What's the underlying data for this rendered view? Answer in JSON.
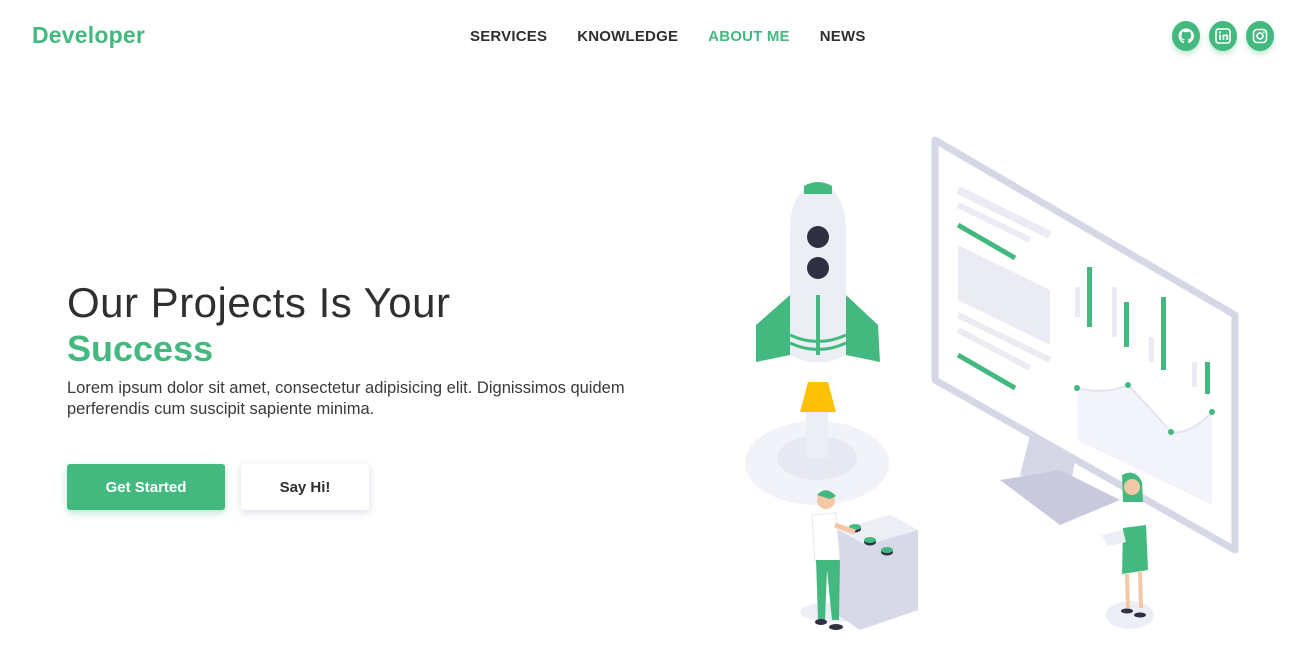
{
  "nav": {
    "logo": "Developer",
    "links": [
      {
        "label": "SERVICES"
      },
      {
        "label": "KNOWLEDGE"
      },
      {
        "label": "ABOUT ME",
        "active": true
      },
      {
        "label": "NEWS"
      }
    ],
    "socials": [
      "github-icon",
      "linkedin-icon",
      "instagram-icon"
    ]
  },
  "hero": {
    "title_line1": "Our Projects Is Your",
    "title_line2": "Success",
    "description": "Lorem ipsum dolor sit amet, consectetur adipisicing elit. Dignissimos quidem perferendis cum suscipit sapiente minima.",
    "primary_button": "Get Started",
    "secondary_button": "Say Hi!"
  },
  "colors": {
    "accent": "#43b97f",
    "text": "#2f2f2f",
    "rocket_flame": "#ffc107",
    "monitor": "#d5d6e6"
  }
}
